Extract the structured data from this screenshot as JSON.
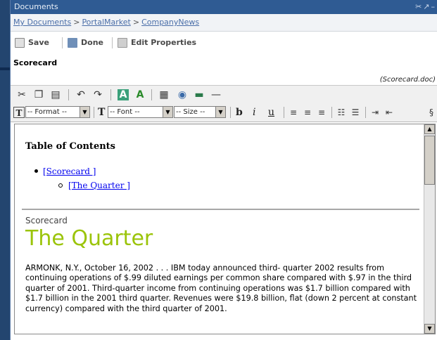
{
  "window": {
    "title": "Documents",
    "controls": "✂↗–"
  },
  "breadcrumb": {
    "items": [
      {
        "label": "My Documents"
      },
      {
        "label": "PortalMarket"
      },
      {
        "label": "CompanyNews"
      }
    ],
    "separator": ">"
  },
  "actions": {
    "save": "Save",
    "done": "Done",
    "edit_properties": "Edit Properties"
  },
  "document": {
    "title": "Scorecard",
    "filename": "(Scorecard.doc)"
  },
  "toolbar": {
    "format_select": "-- Format --",
    "font_select": "-- Font --",
    "size_select": "-- Size --",
    "bold": "b",
    "italic": "i",
    "underline": "u",
    "format_marker": "T",
    "font_marker": "T",
    "color_marker": "A"
  },
  "editor": {
    "toc_heading": "Table of Contents",
    "toc_items": [
      {
        "label": "[Scorecard ]"
      },
      {
        "label": "[The Quarter ]"
      }
    ],
    "section_label": "Scorecard",
    "headline": "The Quarter",
    "body": "ARMONK, N.Y., October 16, 2002 . . . IBM today announced third- quarter 2002 results from continuing operations of $.99 diluted earnings per common share compared with $.97 in the third quarter of 2001. Third-quarter income from continuing operations was $1.7 billion compared with $1.7 billion in the 2001 third quarter. Revenues were $19.8 billion, flat (down 2 percent at constant currency) compared with the third quarter of 2001."
  },
  "colors": {
    "titlebar": "#2f5b93",
    "headline": "#9bc40a",
    "link": "#0000ee"
  }
}
